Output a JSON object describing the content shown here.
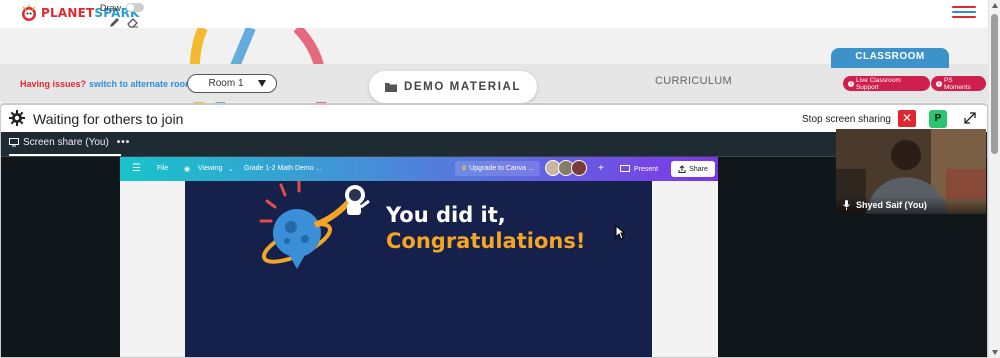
{
  "header": {
    "logo_text_a": "PLANET",
    "logo_text_b": "SPARK",
    "draw_label": "Draw"
  },
  "room_bar": {
    "issues_text": "Having issues?",
    "switch_link": "switch to alternate room",
    "room_selected": "Room 1",
    "demo_material": "DEMO MATERIAL",
    "curriculum": "CURRICULUM",
    "classroom_tab": "CLASSROOM",
    "live_support": "Live Classroom Support",
    "ps_moments": "PS Moments"
  },
  "share_panel": {
    "waiting_text": "Waiting for others to join",
    "stop_sharing": "Stop screen sharing",
    "participant_initial": "P",
    "screen_share_tab": "Screen share (You)",
    "more": "•••"
  },
  "canva": {
    "file": "File",
    "viewing": "Viewing",
    "doc_title": "Grade 1-2 Math Demo ...",
    "upgrade": "Upgrade to Canva ...",
    "plus": "+",
    "present": "Present",
    "share": "Share"
  },
  "slide": {
    "line1": "You did it,",
    "line2": "Congratulations!"
  },
  "video": {
    "participant_name": "Shyed Saif (You)"
  },
  "colors": {
    "brand_red": "#e0282f",
    "brand_blue": "#2c8fd6",
    "pill_red": "#cf1f4d",
    "classroom_blue": "#3d92c9",
    "slide_navy": "#15204b",
    "congrats_orange": "#f5a524",
    "participant_green": "#2cc56f"
  },
  "icons": {
    "logo": "planetspark-logo-icon",
    "pencil": "pencil-icon",
    "eraser": "eraser-icon",
    "menu": "hamburger-menu-icon",
    "folder": "folder-icon",
    "settings": "gear-icon",
    "close": "close-icon",
    "expand": "expand-icon",
    "screen": "screen-share-icon",
    "mic": "microphone-icon",
    "cursor": "mouse-cursor-icon"
  }
}
